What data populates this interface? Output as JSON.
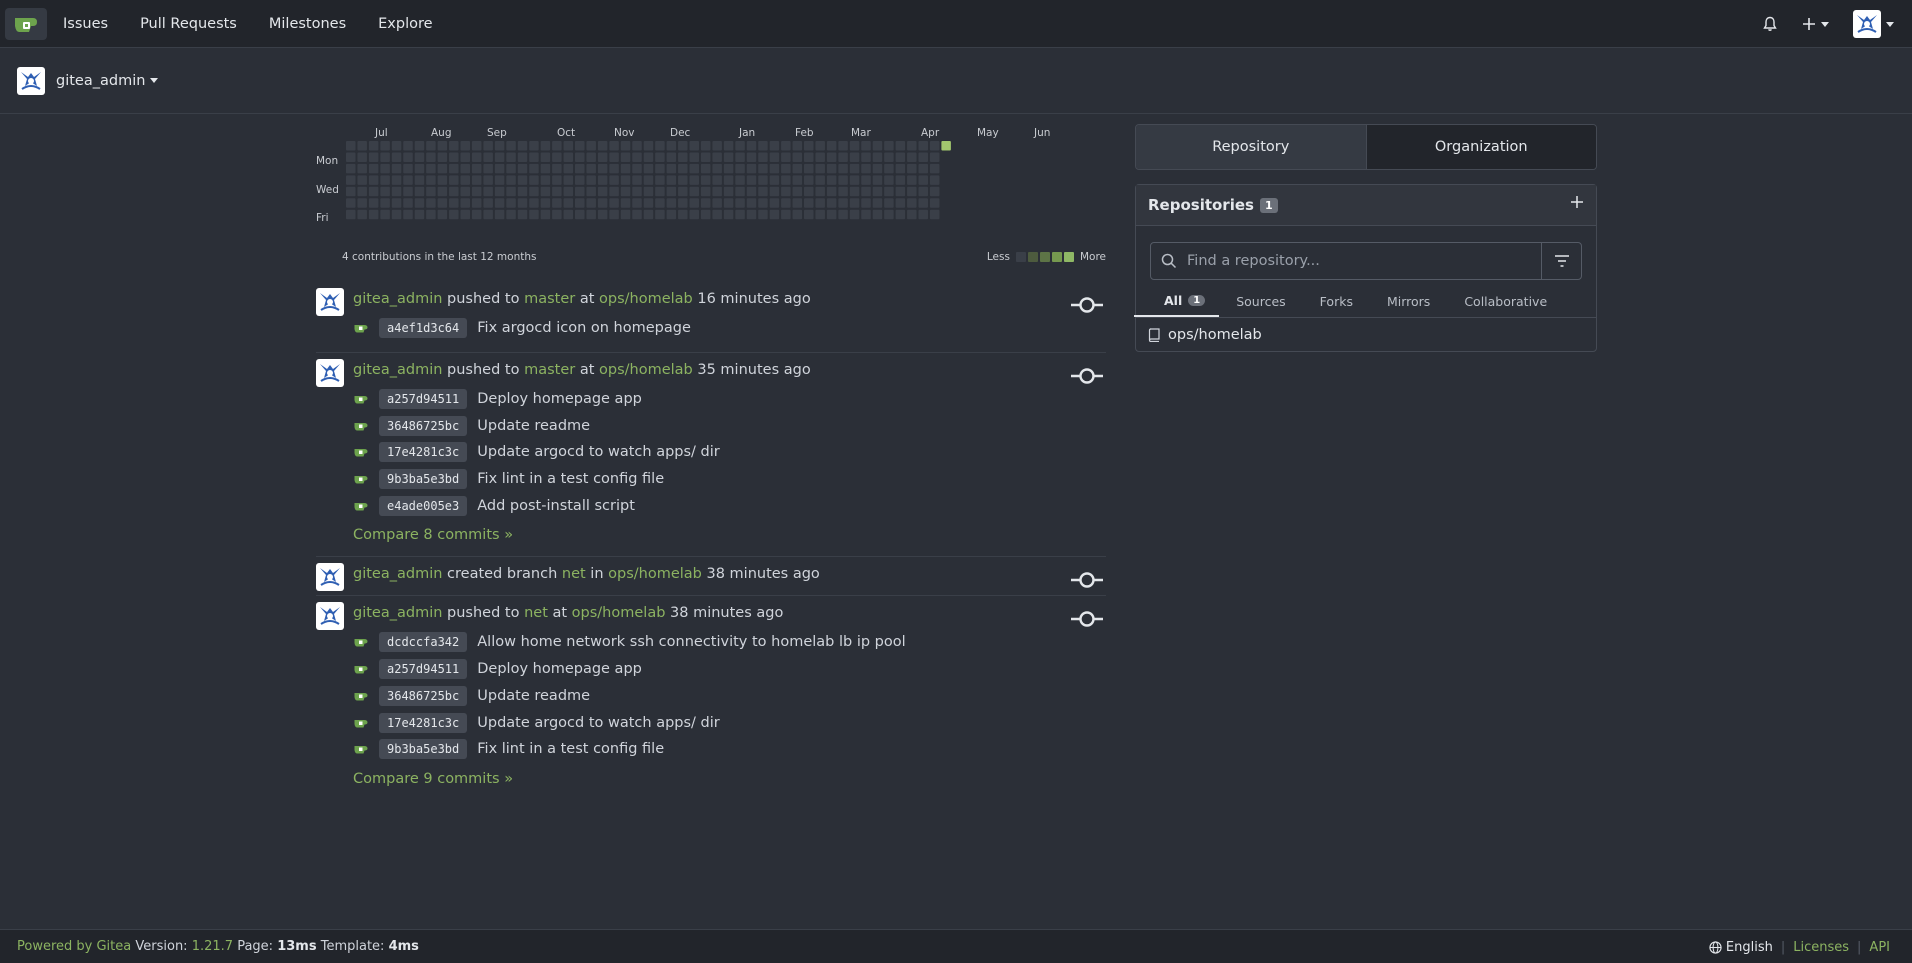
{
  "nav": {
    "items": [
      "Issues",
      "Pull Requests",
      "Milestones",
      "Explore"
    ]
  },
  "context": {
    "user": "gitea_admin"
  },
  "heatmap": {
    "months": [
      "Jul",
      "Aug",
      "Sep",
      "Oct",
      "Nov",
      "Dec",
      "Jan",
      "Feb",
      "Mar",
      "Apr",
      "May",
      "Jun"
    ],
    "days": [
      "Mon",
      "Wed",
      "Fri"
    ],
    "summary": "4 contributions in the last 12 months",
    "legend_less": "Less",
    "legend_more": "More",
    "colors": {
      "empty": "#3a3f48",
      "l1": "#4d5b3e",
      "l2": "#5d7446",
      "l3": "#76994f",
      "l4": "#8fb865",
      "active": "#a3c86e"
    }
  },
  "feed": [
    {
      "user": "gitea_admin",
      "action": "pushed to",
      "ref": "master",
      "prep": "at",
      "repo": "ops/homelab",
      "time": "16 minutes ago",
      "commits": [
        {
          "sha": "a4ef1d3c64",
          "msg": "Fix argocd icon on homepage"
        }
      ],
      "compare": ""
    },
    {
      "user": "gitea_admin",
      "action": "pushed to",
      "ref": "master",
      "prep": "at",
      "repo": "ops/homelab",
      "time": "35 minutes ago",
      "commits": [
        {
          "sha": "a257d94511",
          "msg": "Deploy homepage app"
        },
        {
          "sha": "36486725bc",
          "msg": "Update readme"
        },
        {
          "sha": "17e4281c3c",
          "msg": "Update argocd to watch apps/ dir"
        },
        {
          "sha": "9b3ba5e3bd",
          "msg": "Fix lint in a test config file"
        },
        {
          "sha": "e4ade005e3",
          "msg": "Add post-install script"
        }
      ],
      "compare": "Compare 8 commits »"
    },
    {
      "user": "gitea_admin",
      "action": "created branch",
      "ref": "net",
      "prep": "in",
      "repo": "ops/homelab",
      "time": "38 minutes ago",
      "commits": [],
      "compare": ""
    },
    {
      "user": "gitea_admin",
      "action": "pushed to",
      "ref": "net",
      "prep": "at",
      "repo": "ops/homelab",
      "time": "38 minutes ago",
      "commits": [
        {
          "sha": "dcdccfa342",
          "msg": "Allow home network ssh connectivity to homelab lb ip pool"
        },
        {
          "sha": "a257d94511",
          "msg": "Deploy homepage app"
        },
        {
          "sha": "36486725bc",
          "msg": "Update readme"
        },
        {
          "sha": "17e4281c3c",
          "msg": "Update argocd to watch apps/ dir"
        },
        {
          "sha": "9b3ba5e3bd",
          "msg": "Fix lint in a test config file"
        }
      ],
      "compare": "Compare 9 commits »"
    }
  ],
  "panel": {
    "tabs": [
      "Repository",
      "Organization"
    ],
    "title": "Repositories",
    "count": "1",
    "search_placeholder": "Find a repository...",
    "filters": [
      {
        "label": "All",
        "count": "1"
      },
      {
        "label": "Sources"
      },
      {
        "label": "Forks"
      },
      {
        "label": "Mirrors"
      },
      {
        "label": "Collaborative"
      }
    ],
    "repos": [
      "ops/homelab"
    ]
  },
  "footer": {
    "powered": "Powered by Gitea",
    "version_label": "Version:",
    "version": "1.21.7",
    "page_label": "Page:",
    "page": "13ms",
    "template_label": "Template:",
    "template": "4ms",
    "language": "English",
    "licenses": "Licenses",
    "api": "API"
  }
}
